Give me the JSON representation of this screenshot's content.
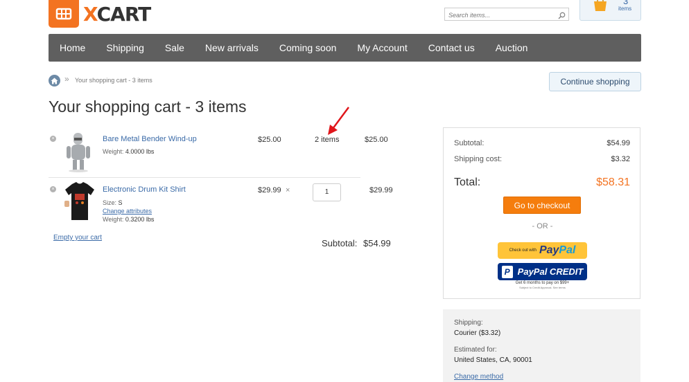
{
  "header": {
    "logo_text": "CART",
    "logo_prefix": "X",
    "search_placeholder": "Search items...",
    "minicart": {
      "count": "3",
      "label": "items"
    }
  },
  "nav": {
    "items": [
      "Home",
      "Shipping",
      "Sale",
      "New arrivals",
      "Coming soon",
      "My Account",
      "Contact us",
      "Auction"
    ]
  },
  "breadcrumb": {
    "separator": "»",
    "current": "Your shopping cart - 3 items"
  },
  "continue_label": "Continue shopping",
  "page_title": "Your shopping cart - 3 items",
  "cart": {
    "items": [
      {
        "name": "Bare Metal Bender Wind-up",
        "weight_label": "Weight:",
        "weight": "4.0000 lbs",
        "price": "$25.00",
        "qty": "2 items",
        "subtotal": "$25.00"
      },
      {
        "name": "Electronic Drum Kit Shirt",
        "size_label": "Size:",
        "size": "S",
        "change_attributes": "Change attributes",
        "weight_label": "Weight:",
        "weight": "0.3200 lbs",
        "price": "$29.99",
        "times": "×",
        "qty": "1",
        "subtotal": "$29.99"
      }
    ],
    "remove_glyph": "×",
    "empty_link": "Empty your cart",
    "subtotal_label": "Subtotal:",
    "subtotal_value": "$54.99"
  },
  "summary": {
    "subtotal_label": "Subtotal:",
    "subtotal_value": "$54.99",
    "shipping_label": "Shipping cost:",
    "shipping_value": "$3.32",
    "total_label": "Total:",
    "total_value": "$58.31",
    "checkout_label": "Go to checkout",
    "or_label": "- OR -",
    "paypal_small": "Check out with",
    "paypal_a": "Pay",
    "paypal_b": "Pal",
    "paypal_credit": "PayPal CREDIT",
    "paypal_credit_icon": "P",
    "credit_note": "Get 6 months to pay on $99+",
    "credit_subnote": "Subject to Credit Approval. See terms"
  },
  "shipping_info": {
    "label": "Shipping:",
    "method": "Courier ($3.32)",
    "estimated_label": "Estimated for:",
    "estimated_value": "United States, CA, 90001",
    "change_link": "Change method"
  },
  "colors": {
    "accent": "#f37321",
    "nav_bg": "#5f5f5f",
    "link": "#3a6aa7",
    "paypal_yellow": "#ffc439",
    "paypal_blue": "#003087"
  }
}
